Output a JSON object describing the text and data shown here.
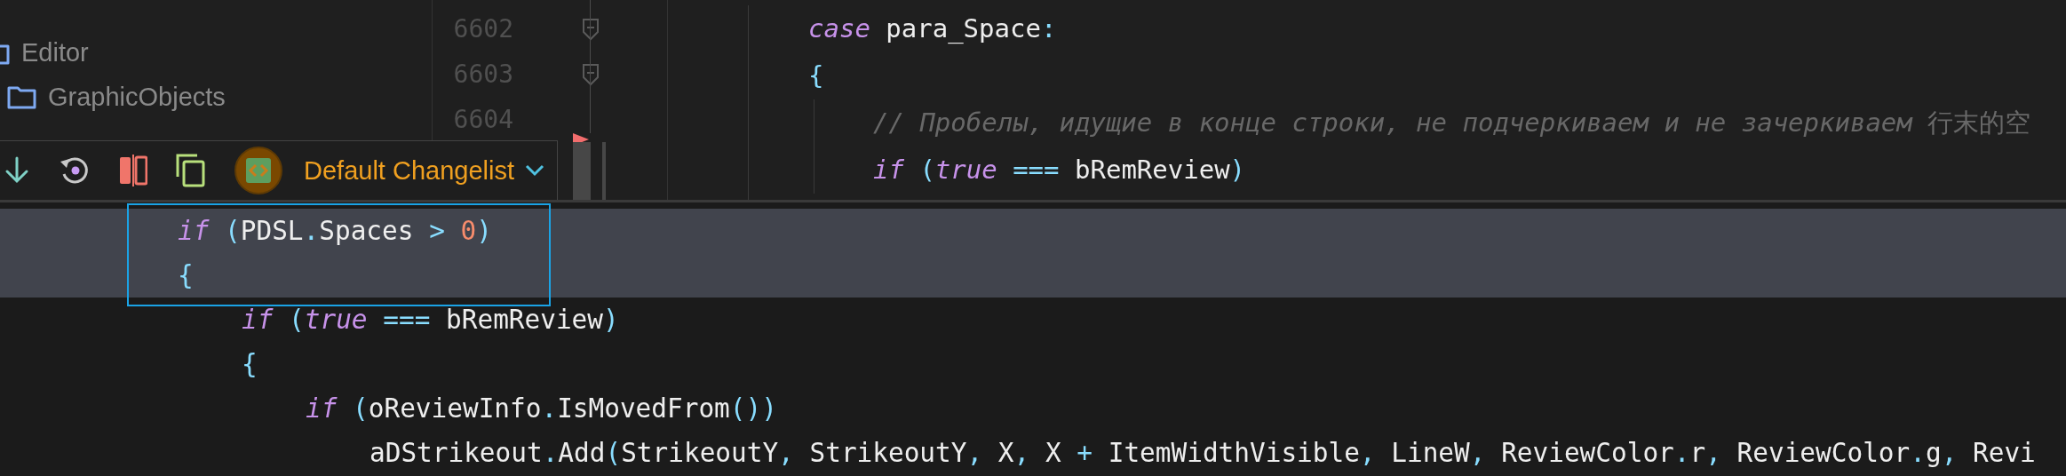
{
  "sidebar": {
    "items": [
      {
        "label": "Editor",
        "kind": "folder"
      },
      {
        "label": "GraphicObjects",
        "kind": "folder"
      }
    ]
  },
  "gutter": {
    "lines": [
      {
        "number": "6602",
        "foldable": true
      },
      {
        "number": "6603",
        "foldable": true
      },
      {
        "number": "6604"
      }
    ]
  },
  "changes_toolbar": {
    "changelist": "Default Changelist"
  },
  "editor": {
    "lines": [
      {
        "tokens": [
          {
            "kind": "keyword",
            "text": "case"
          },
          {
            "kind": "ident",
            "text": " para_Space"
          },
          {
            "kind": "punct",
            "text": ":"
          }
        ]
      },
      {
        "tokens": [
          {
            "kind": "punct",
            "text": "{"
          }
        ],
        "children": [
          {
            "tokens": [
              {
                "kind": "comment",
                "text": "// Пробелы, идущие в конце строки, не подчеркиваем и не зачеркиваем "
              },
              {
                "kind": "cjk",
                "text": "行末的空"
              }
            ]
          },
          {
            "tokens": [
              {
                "kind": "keyword",
                "text": "if"
              },
              {
                "kind": "punct",
                "text": " ("
              },
              {
                "kind": "keyword",
                "text": "true"
              },
              {
                "kind": "punct",
                "text": " === "
              },
              {
                "kind": "ident",
                "text": "bRemReview"
              },
              {
                "kind": "punct",
                "text": ")"
              }
            ]
          }
        ]
      }
    ]
  },
  "zoom_view": {
    "lines": [
      {
        "highlighted": true,
        "tokens": [
          {
            "kind": "keyword",
            "text": "if"
          },
          {
            "kind": "punct",
            "text": " ("
          },
          {
            "kind": "ident",
            "text": "PDSL"
          },
          {
            "kind": "punct",
            "text": "."
          },
          {
            "kind": "ident",
            "text": "Spaces"
          },
          {
            "kind": "punct",
            "text": " > "
          },
          {
            "kind": "number",
            "text": "0"
          },
          {
            "kind": "punct",
            "text": ")"
          }
        ]
      },
      {
        "highlighted": true,
        "tokens": [
          {
            "kind": "punct",
            "text": "{"
          }
        ],
        "children": [
          {
            "highlighted": false,
            "tokens": [
              {
                "kind": "keyword",
                "text": "if"
              },
              {
                "kind": "punct",
                "text": " ("
              },
              {
                "kind": "keyword",
                "text": "true"
              },
              {
                "kind": "punct",
                "text": " === "
              },
              {
                "kind": "ident",
                "text": "bRemReview"
              },
              {
                "kind": "punct",
                "text": ")"
              }
            ]
          },
          {
            "highlighted": false,
            "tokens": [
              {
                "kind": "punct",
                "text": "{"
              }
            ],
            "children": [
              {
                "highlighted": false,
                "tokens": [
                  {
                    "kind": "keyword",
                    "text": "if"
                  },
                  {
                    "kind": "punct",
                    "text": " ("
                  },
                  {
                    "kind": "ident",
                    "text": "oReviewInfo"
                  },
                  {
                    "kind": "punct",
                    "text": "."
                  },
                  {
                    "kind": "ident",
                    "text": "IsMovedFrom"
                  },
                  {
                    "kind": "punct",
                    "text": "())"
                  }
                ],
                "children": [
                  {
                    "highlighted": false,
                    "tokens": [
                      {
                        "kind": "ident",
                        "text": "aDStrikeout"
                      },
                      {
                        "kind": "punct",
                        "text": "."
                      },
                      {
                        "kind": "ident",
                        "text": "Add"
                      },
                      {
                        "kind": "punct",
                        "text": "("
                      },
                      {
                        "kind": "ident",
                        "text": "StrikeoutY"
                      },
                      {
                        "kind": "punct",
                        "text": ", "
                      },
                      {
                        "kind": "ident",
                        "text": "StrikeoutY"
                      },
                      {
                        "kind": "punct",
                        "text": ", "
                      },
                      {
                        "kind": "ident",
                        "text": "X"
                      },
                      {
                        "kind": "punct",
                        "text": ", "
                      },
                      {
                        "kind": "ident",
                        "text": "X"
                      },
                      {
                        "kind": "punct",
                        "text": " + "
                      },
                      {
                        "kind": "ident",
                        "text": "ItemWidthVisible"
                      },
                      {
                        "kind": "punct",
                        "text": ", "
                      },
                      {
                        "kind": "ident",
                        "text": "LineW"
                      },
                      {
                        "kind": "punct",
                        "text": ", "
                      },
                      {
                        "kind": "ident",
                        "text": "ReviewColor"
                      },
                      {
                        "kind": "punct",
                        "text": "."
                      },
                      {
                        "kind": "ident",
                        "text": "r"
                      },
                      {
                        "kind": "punct",
                        "text": ", "
                      },
                      {
                        "kind": "ident",
                        "text": "ReviewColor"
                      },
                      {
                        "kind": "punct",
                        "text": "."
                      },
                      {
                        "kind": "ident",
                        "text": "g"
                      },
                      {
                        "kind": "punct",
                        "text": ", "
                      },
                      {
                        "kind": "ident",
                        "text": "Revi"
                      }
                    ]
                  }
                ]
              }
            ]
          }
        ]
      }
    ]
  }
}
